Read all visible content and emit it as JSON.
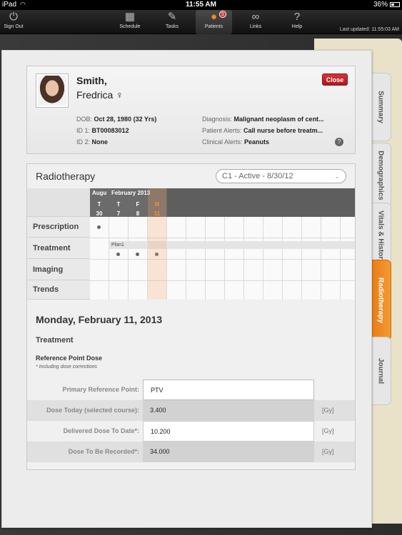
{
  "status": {
    "carrier": "iPad",
    "time": "11:55 AM",
    "battery": "36%"
  },
  "toolbar": {
    "sign_out": "Sign Out",
    "schedule": "Schedule",
    "tasks": "Tasks",
    "patients": "Patients",
    "patients_badge": "5",
    "links": "Links",
    "help": "Help",
    "last_updated": "Last updated: 11:55:03 AM"
  },
  "patient": {
    "last_name": "Smith,",
    "first_name": "Fredrica",
    "gender_symbol": "♀",
    "close_label": "Close",
    "dob_label": "DOB:",
    "dob": "Oct 28, 1980 (32 Yrs)",
    "id1_label": "ID 1:",
    "id1": "BT00083012",
    "id2_label": "ID 2:",
    "id2": "None",
    "diagnosis_label": "Diagnosis:",
    "diagnosis": "Malignant neoplasm of cent...",
    "patient_alerts_label": "Patient Alerts:",
    "patient_alerts": "Call nurse before treatm...",
    "clinical_alerts_label": "Clinical Alerts:",
    "clinical_alerts": "Peanuts"
  },
  "tabs": [
    "Summary",
    "Demographics",
    "Vitals & History",
    "Radiotherapy",
    "Journal"
  ],
  "radiotherapy": {
    "title": "Radiotherapy",
    "course": "C1 - Active - 8/30/12",
    "months": [
      "Augu",
      "February 2013"
    ],
    "days": [
      {
        "dow": "T",
        "day": "30"
      },
      {
        "dow": "T",
        "day": "7"
      },
      {
        "dow": "F",
        "day": "8"
      },
      {
        "dow": "M",
        "day": "11"
      }
    ],
    "rows": [
      "Prescription",
      "Treatment",
      "Imaging",
      "Trends"
    ],
    "plan_label": "Plan1",
    "detail_date": "Monday, February 11, 2013",
    "detail_section": "Treatment",
    "ref_point_title": "Reference Point Dose",
    "ref_point_note": "* Including dose corrections",
    "doses": [
      {
        "label": "Primary Reference Point:",
        "value": "PTV",
        "unit": ""
      },
      {
        "label": "Dose Today (selected course):",
        "value": "3.400",
        "unit": "[Gy]"
      },
      {
        "label": "Delivered Dose To Date*:",
        "value": "10.200",
        "unit": "[Gy]"
      },
      {
        "label": "Dose To Be Recorded*:",
        "value": "34.000",
        "unit": "[Gy]"
      }
    ]
  },
  "colors": {
    "accent": "#f08a20",
    "close": "#c8242b"
  }
}
